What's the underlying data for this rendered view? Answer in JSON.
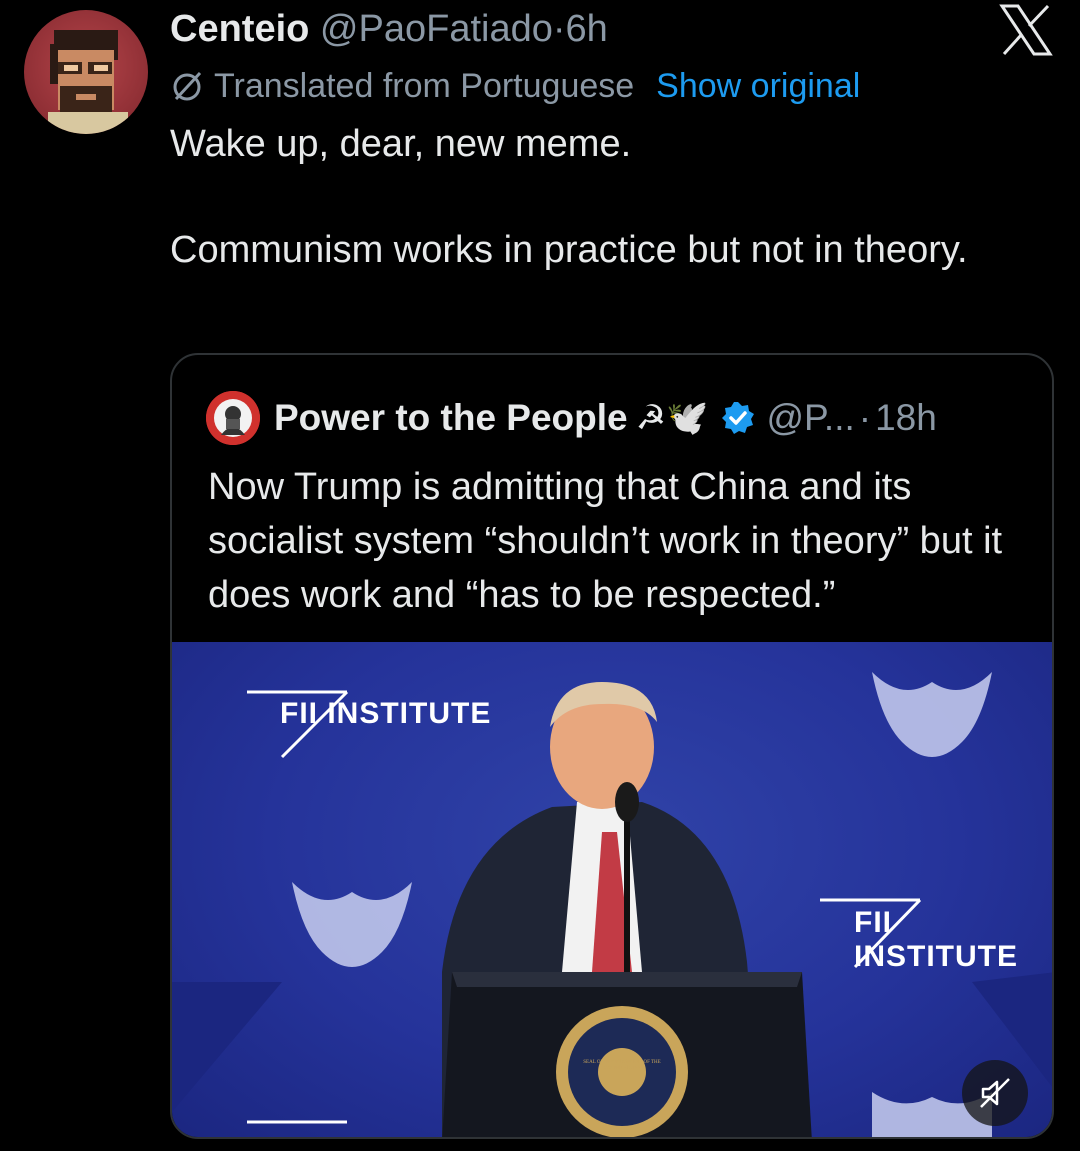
{
  "tweet": {
    "display_name": "Centeio",
    "handle": "@PaoFatiado",
    "separator": "·",
    "time": "6h",
    "translated_label": "Translated from Portuguese",
    "show_original_label": "Show original",
    "body_line1": "Wake up, dear, new meme.",
    "body_line2": "Communism works in practice but not in theory."
  },
  "quote": {
    "display_name": "Power to the People",
    "emoji": "☭🕊️",
    "handle": "@P...",
    "separator": "·",
    "time": "18h",
    "text": "Now Trump is admitting that China and its socialist system “shouldn’t work in theory” but it does work and “has to be respected.”"
  },
  "media": {
    "logo_text_1": "FII INSTITUTE",
    "logo_text_2": "FII INSTITUTE",
    "seal_text": "SEAL OF THE PRESIDENT OF THE UNITED STATES",
    "mute_icon": "muted-speaker-icon"
  },
  "colors": {
    "background": "#000000",
    "text": "#e7e9ea",
    "secondary": "#8b98a5",
    "accent": "#1d9bf0",
    "card_border": "#2f3336",
    "stage_blue": "#25339a"
  },
  "icons": {
    "close": "x-logo-icon",
    "translate": "translate-icon",
    "verified": "verified-badge-icon"
  }
}
